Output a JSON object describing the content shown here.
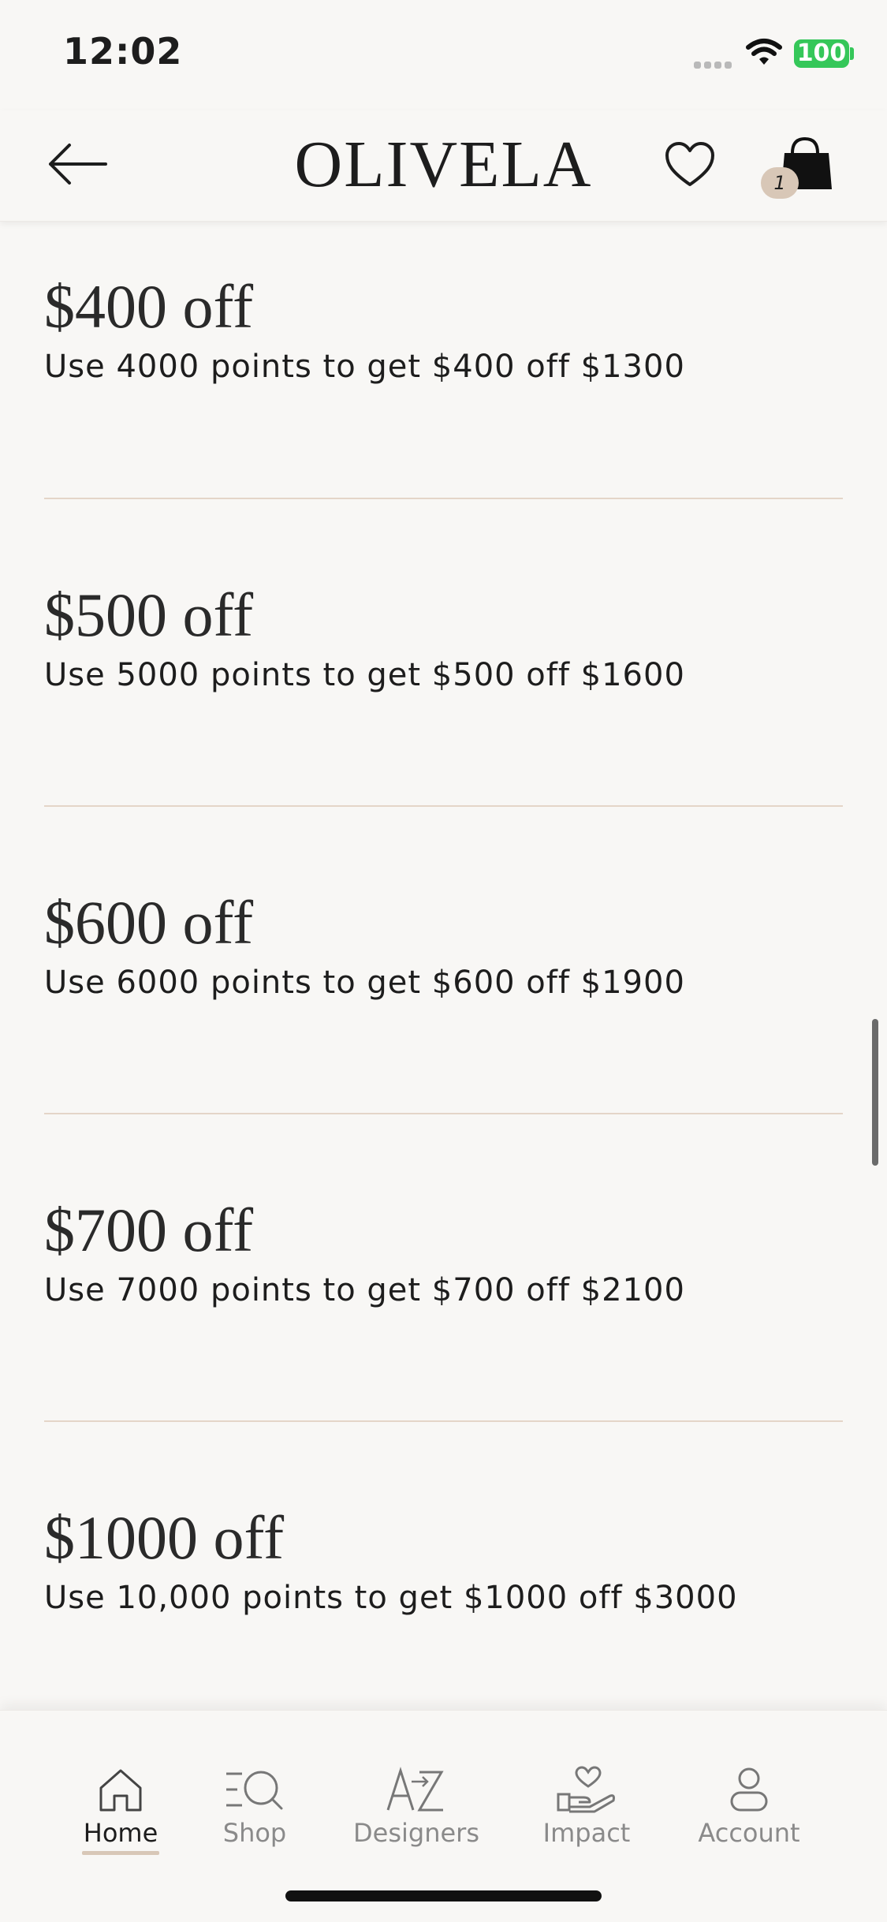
{
  "status_bar": {
    "time": "12:02",
    "battery": "100"
  },
  "header": {
    "brand": "OLIVELA",
    "bag_count": "1"
  },
  "offers": [
    {
      "title": "$400 off",
      "description": "Use 4000 points to get $400 off $1300"
    },
    {
      "title": "$500 off",
      "description": "Use 5000 points to get $500 off $1600"
    },
    {
      "title": "$600 off",
      "description": "Use 6000 points to get $600 off $1900"
    },
    {
      "title": "$700 off",
      "description": "Use 7000 points to get $700 off $2100"
    },
    {
      "title": "$1000 off",
      "description": "Use 10,000 points to get $1000 off $3000"
    }
  ],
  "tab_bar": {
    "items": [
      {
        "label": "Home",
        "icon": "home-icon",
        "active": true
      },
      {
        "label": "Shop",
        "icon": "shop-search-icon",
        "active": false
      },
      {
        "label": "Designers",
        "icon": "a-z-icon",
        "active": false
      },
      {
        "label": "Impact",
        "icon": "heart-hand-icon",
        "active": false
      },
      {
        "label": "Account",
        "icon": "person-icon",
        "active": false
      }
    ]
  },
  "colors": {
    "background": "#f8f7f5",
    "accent": "#d8c7b7",
    "divider": "#e4d5c8",
    "battery": "#35c759"
  }
}
